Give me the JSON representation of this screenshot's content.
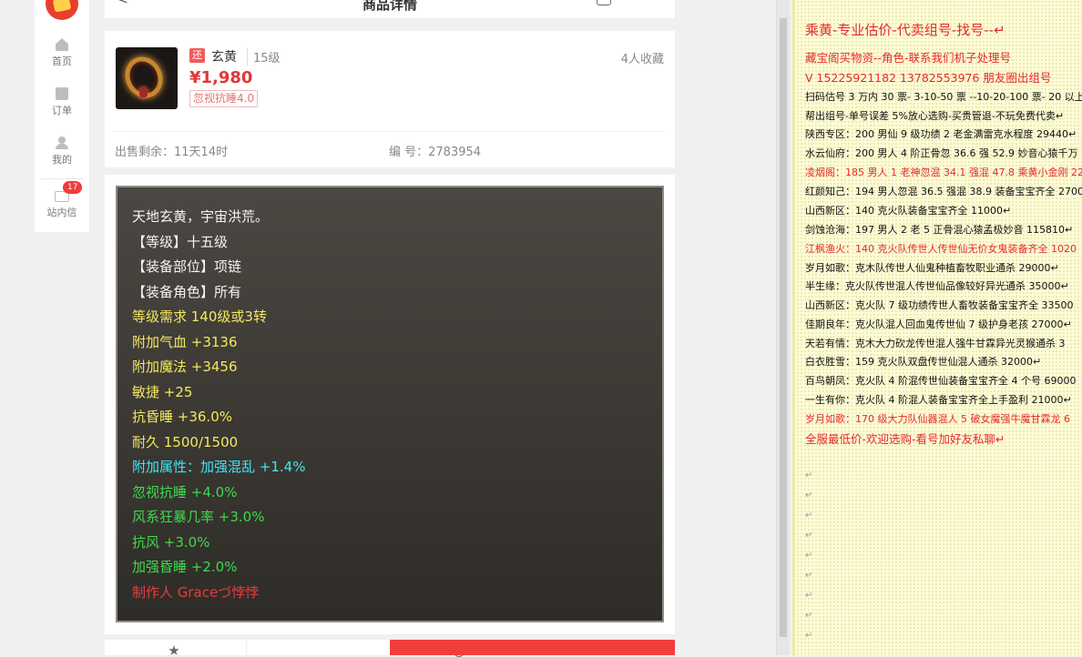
{
  "sidebar": {
    "items": [
      {
        "label": "首页",
        "icon": "home-icon"
      },
      {
        "label": "订单",
        "icon": "order-icon"
      },
      {
        "label": "我的",
        "icon": "user-icon"
      },
      {
        "label": "站内信",
        "icon": "mail-icon",
        "badge": "17"
      }
    ]
  },
  "header": {
    "back": "<",
    "title": "商品详情"
  },
  "product": {
    "tag": "还",
    "name": "玄黄",
    "level": "15级",
    "price": "¥1,980",
    "attr_tag": "忽视抗睡4.0",
    "favorites": "4人收藏",
    "remaining": "出售剩余：11天14时",
    "serial": "编 号：2783954"
  },
  "stats": [
    {
      "text": "天地玄黄，宇宙洪荒。",
      "color": "white"
    },
    {
      "text": "【等级】十五级",
      "color": "white"
    },
    {
      "text": "【装备部位】项链",
      "color": "white"
    },
    {
      "text": "【装备角色】所有",
      "color": "white"
    },
    {
      "text": "等级需求 140级或3转",
      "color": "yellow"
    },
    {
      "text": "附加气血 +3136",
      "color": "yellow"
    },
    {
      "text": "附加魔法 +3456",
      "color": "yellow"
    },
    {
      "text": "敏捷 +25",
      "color": "yellow"
    },
    {
      "text": "抗昏睡 +36.0%",
      "color": "yellow"
    },
    {
      "text": "耐久 1500/1500",
      "color": "yellow"
    },
    {
      "text": "附加属性：加强混乱 +1.4%",
      "color": "cyan"
    },
    {
      "text": "忽视抗睡 +4.0%",
      "color": "green"
    },
    {
      "text": "风系狂暴几率 +3.0%",
      "color": "green"
    },
    {
      "text": "抗风 +3.0%",
      "color": "green"
    },
    {
      "text": "加强昏睡 +2.0%",
      "color": "green"
    },
    {
      "text": "制作人 Graceづ悖悖",
      "color": "red"
    }
  ],
  "doc": {
    "lines": [
      {
        "text": "乘黄-专业估价-代卖组号-找号--↵",
        "style": "red big"
      },
      {
        "text": "藏宝阁买物资--角色-联系我们机子处理号",
        "style": "red mid"
      },
      {
        "text": "V 15225921182   13782553976 朋友圈出组号",
        "style": "red mid"
      },
      {
        "text": "扫码估号 3 万内 30 票- 3-10-50 票  --10-20-100 票- 20 以上 1",
        "style": ""
      },
      {
        "text": "帮出组号-单号误差 5%放心选购-买贵管退-不玩免费代卖↵",
        "style": ""
      },
      {
        "text": "陕西专区：200 男仙 9 级功绩 2 老金满雷克水程度 29440↵",
        "style": ""
      },
      {
        "text": "水云仙府：200 男人 4 阶正骨忽 36.6 强 52.9 妙音心猿千万",
        "style": ""
      },
      {
        "text": "凌烟阁：185 男人 1 老神忽混 34.1 强混 47.8 乘黄小金刚 22",
        "style": "red"
      },
      {
        "text": "红颜知己：194 男人忽混 36.5 强混 38.9 装备宝宝齐全 2700",
        "style": ""
      },
      {
        "text": "山西新区：140 克火队装备宝宝齐全 11000↵",
        "style": ""
      },
      {
        "text": "剑蚀沧海：197 男人 2 老 5 正骨混心猿孟极妙音 115810↵",
        "style": ""
      },
      {
        "text": "江枫渔火：140 克火队传世人传世仙无价女鬼装备齐全 1020",
        "style": "red"
      },
      {
        "text": "岁月如歌：克木队传世人仙鬼种植畜牧职业通杀 29000↵",
        "style": ""
      },
      {
        "text": "半生缘：克火队传世混人传世仙品像较好异光通杀 35000↵",
        "style": ""
      },
      {
        "text": "山西新区：克火队 7 级功绩传世人畜牧装备宝宝齐全 33500",
        "style": ""
      },
      {
        "text": "佳期良年：克火队混人回血鬼传世仙 7 级护身老孩 27000↵",
        "style": ""
      },
      {
        "text": "天若有情：克木大力砍龙传世混人强牛甘霖异光灵猴通杀 3",
        "style": ""
      },
      {
        "text": "白衣胜雪：159 克火队双盘传世仙混人通杀 32000↵",
        "style": ""
      },
      {
        "text": "百鸟朝凤：克火队 4 阶混传世仙装备宝宝齐全 4 个号 69000",
        "style": ""
      },
      {
        "text": "一生有你：克火队 4 阶混人装备宝宝齐全上手盈利 21000↵",
        "style": ""
      },
      {
        "text": "岁月如歌：170 级大力队仙器混人 5 破女魔强牛魔甘霖龙 6",
        "style": "red"
      },
      {
        "text": "全服最低价-欢迎选购-看号加好友私聊↵",
        "style": "red mid"
      }
    ],
    "empty_mark": "↵"
  }
}
